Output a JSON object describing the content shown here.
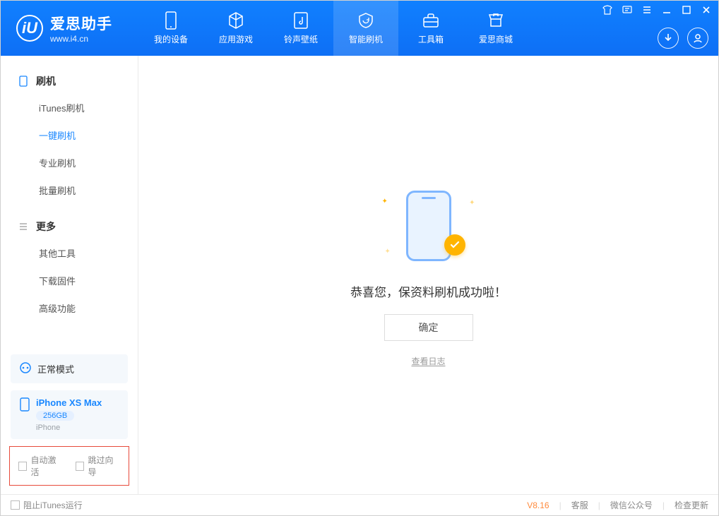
{
  "app": {
    "logo_title": "爱思助手",
    "logo_sub": "www.i4.cn",
    "logo_letter": "iU"
  },
  "top_tabs": [
    {
      "label": "我的设备",
      "icon": "phone"
    },
    {
      "label": "应用游戏",
      "icon": "cube"
    },
    {
      "label": "铃声壁纸",
      "icon": "music"
    },
    {
      "label": "智能刷机",
      "icon": "refresh",
      "active": true
    },
    {
      "label": "工具箱",
      "icon": "toolbox"
    },
    {
      "label": "爱思商城",
      "icon": "store"
    }
  ],
  "sidebar": {
    "group1_title": "刷机",
    "group1_items": [
      {
        "label": "iTunes刷机"
      },
      {
        "label": "一键刷机",
        "active": true
      },
      {
        "label": "专业刷机"
      },
      {
        "label": "批量刷机"
      }
    ],
    "group2_title": "更多",
    "group2_items": [
      {
        "label": "其他工具"
      },
      {
        "label": "下载固件"
      },
      {
        "label": "高级功能"
      }
    ],
    "mode_label": "正常模式",
    "device_name": "iPhone XS Max",
    "device_capacity": "256GB",
    "device_type": "iPhone",
    "checkbox1": "自动激活",
    "checkbox2": "跳过向导"
  },
  "main": {
    "success_message": "恭喜您，保资料刷机成功啦！",
    "ok_button": "确定",
    "log_link": "查看日志"
  },
  "statusbar": {
    "itunes_block": "阻止iTunes运行",
    "version": "V8.16",
    "link1": "客服",
    "link2": "微信公众号",
    "link3": "检查更新"
  }
}
